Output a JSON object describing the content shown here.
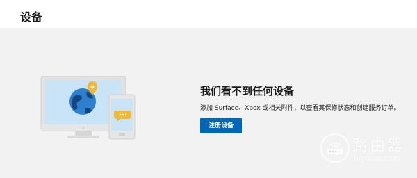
{
  "header": {
    "title": "设备"
  },
  "empty_state": {
    "title": "我们看不到任何设备",
    "description": "添加 Surface、Xbox 或相关附件，以查看其保修状态和创建服务订单。",
    "register_button_label": "注册设备"
  },
  "watermark": {
    "brand": "路由器",
    "domain": "luyouqi.com"
  },
  "colors": {
    "accent": "#0067b8",
    "background": "#f2f2f2",
    "header_bg": "#ffffff",
    "globe": "#2f7fcf",
    "pin": "#f5b82e"
  }
}
